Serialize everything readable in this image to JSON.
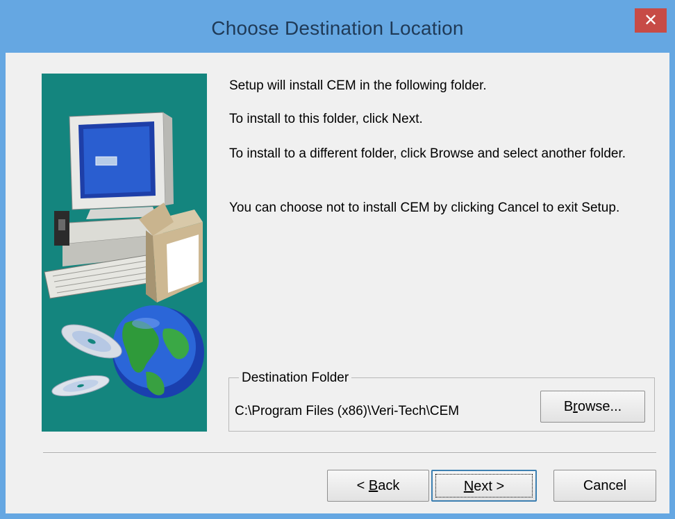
{
  "window": {
    "title": "Choose Destination Location",
    "close_glyph": "✕"
  },
  "instructions": {
    "line1": "Setup will install CEM in the following folder.",
    "line2": "To install to this folder, click Next.",
    "line3": "To install to a different folder, click Browse and select another folder.",
    "line4": "You can choose not to install CEM by clicking Cancel to exit Setup."
  },
  "destination": {
    "group_label": "Destination Folder",
    "path": "C:\\Program Files (x86)\\Veri-Tech\\CEM",
    "browse_pre": "B",
    "browse_ul": "r",
    "browse_post": "owse..."
  },
  "buttons": {
    "back_pre": "< ",
    "back_ul": "B",
    "back_post": "ack",
    "next_ul": "N",
    "next_post": "ext >",
    "cancel": "Cancel"
  },
  "colors": {
    "titlebar": "#65a7e2",
    "close": "#c74b46",
    "art_background": "#14857e"
  }
}
